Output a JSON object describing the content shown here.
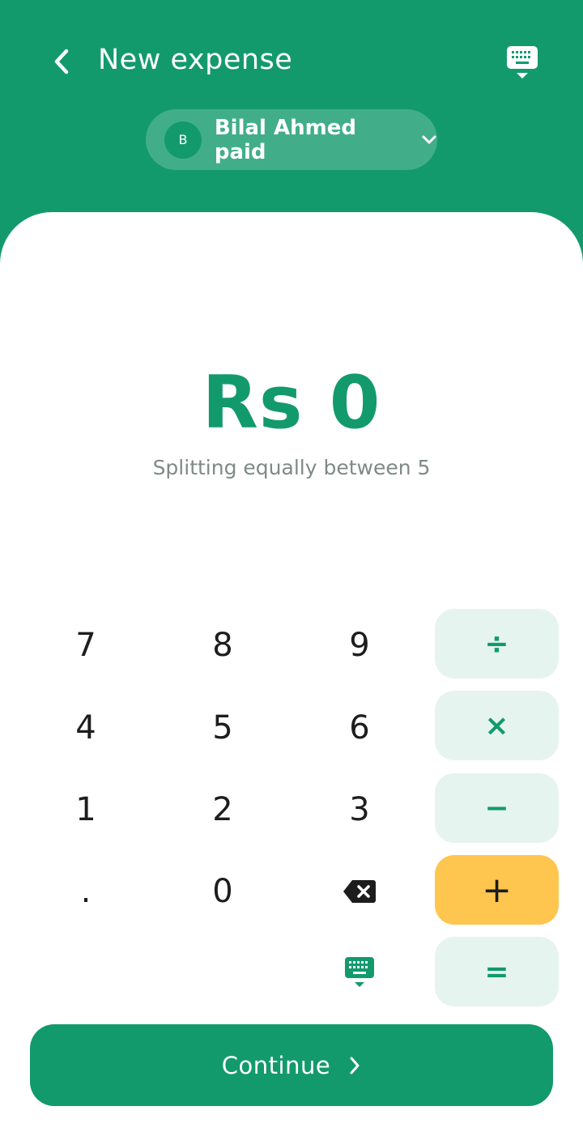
{
  "header": {
    "title": "New expense",
    "back_icon": "chevron-left-icon",
    "keyboard_icon": "keyboard-hide-icon"
  },
  "payer": {
    "avatar_initial": "B",
    "label": "Bilal Ahmed paid",
    "dropdown_icon": "chevron-down-icon"
  },
  "amount": {
    "display": "Rs 0",
    "subtitle": "Splitting equally between 5"
  },
  "keypad": {
    "digits": [
      "7",
      "8",
      "9",
      "4",
      "5",
      "6",
      "1",
      "2",
      "3",
      ".",
      "0"
    ],
    "operators": {
      "divide": "÷",
      "multiply": "×",
      "minus": "−",
      "plus": "+",
      "equals": "="
    },
    "backspace_icon": "backspace-icon",
    "keyboard_icon": "keyboard-hide-icon"
  },
  "footer": {
    "continue_label": "Continue",
    "continue_icon": "chevron-right-icon"
  },
  "colors": {
    "primary": "#139a6c",
    "accent": "#fec64f",
    "operator_bg": "#e6f4ef",
    "subtitle": "#7f8a85"
  }
}
